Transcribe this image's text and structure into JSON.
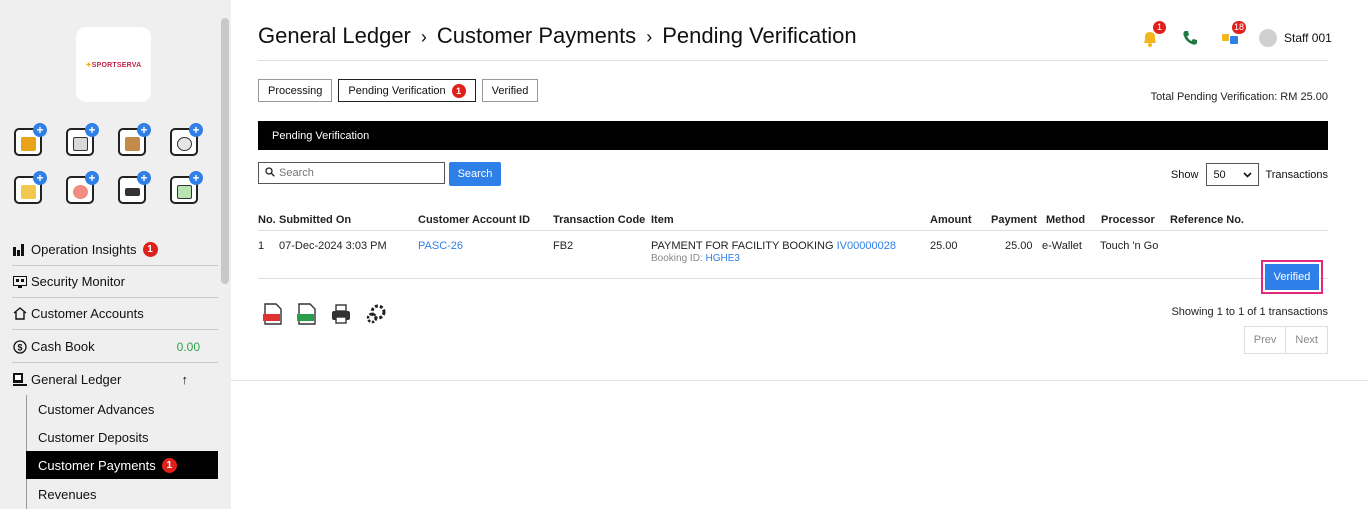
{
  "sidebar": {
    "logo_text": "SPORTSERVA",
    "quick_icons": [
      {
        "icon": "id-card-icon",
        "color": "#e9a21b"
      },
      {
        "icon": "calendar-icon",
        "color": "#d8d8d8"
      },
      {
        "icon": "building-money-icon",
        "color": "#c38a4a"
      },
      {
        "icon": "sports-balls-icon",
        "color": "#e6e6e6"
      },
      {
        "icon": "access-card-icon",
        "color": "#f2c94c"
      },
      {
        "icon": "staff-icon",
        "color": "#f28b82"
      },
      {
        "icon": "number-plate-icon",
        "color": "#333333"
      },
      {
        "icon": "login-screen-icon",
        "color": "#b8e2b0"
      }
    ],
    "nav": [
      {
        "label": "Operation Insights",
        "badge": "1"
      },
      {
        "label": "Security Monitor"
      },
      {
        "label": "Customer Accounts"
      },
      {
        "label": "Cash Book",
        "amount": "0.00"
      },
      {
        "label": "General Ledger",
        "arrow": "↑"
      }
    ],
    "sub_items": [
      {
        "label": "Customer Advances"
      },
      {
        "label": "Customer Deposits"
      },
      {
        "label": "Customer Payments",
        "badge": "1"
      },
      {
        "label": "Revenues"
      }
    ]
  },
  "header": {
    "crumbs": [
      "General Ledger",
      "Customer Payments",
      "Pending Verification"
    ],
    "separator": "›",
    "notification_badge": "1",
    "chat_badge": "18",
    "user_name": "Staff 001"
  },
  "tabs": [
    {
      "label": "Processing"
    },
    {
      "label": "Pending Verification",
      "badge": "1"
    },
    {
      "label": "Verified"
    }
  ],
  "total_text": "Total Pending Verification: RM 25.00",
  "section_title": "Pending Verification",
  "search": {
    "placeholder": "Search",
    "button": "Search"
  },
  "show": {
    "label": "Show",
    "value": "50",
    "suffix": "Transactions"
  },
  "table": {
    "headers": [
      "No.",
      "Submitted On",
      "Customer Account ID",
      "Transaction Code",
      "Item",
      "Amount",
      "Payment",
      "Method",
      "Processor",
      "Reference No."
    ],
    "rows": [
      {
        "no": "1",
        "submitted_on": "07-Dec-2024 3:03 PM",
        "account_id": "PASC-26",
        "code": "FB2",
        "item": "PAYMENT FOR FACILITY BOOKING",
        "item_ref": "IV00000028",
        "booking_label": "Booking ID:",
        "booking_id": "HGHE3",
        "amount": "25.00",
        "payment": "25.00",
        "method": "e-Wallet",
        "processor": "Touch 'n Go",
        "reference": "",
        "action": "Verified"
      }
    ]
  },
  "showing_text": "Showing 1 to 1 of 1 transactions",
  "pager": {
    "prev": "Prev",
    "next": "Next"
  }
}
